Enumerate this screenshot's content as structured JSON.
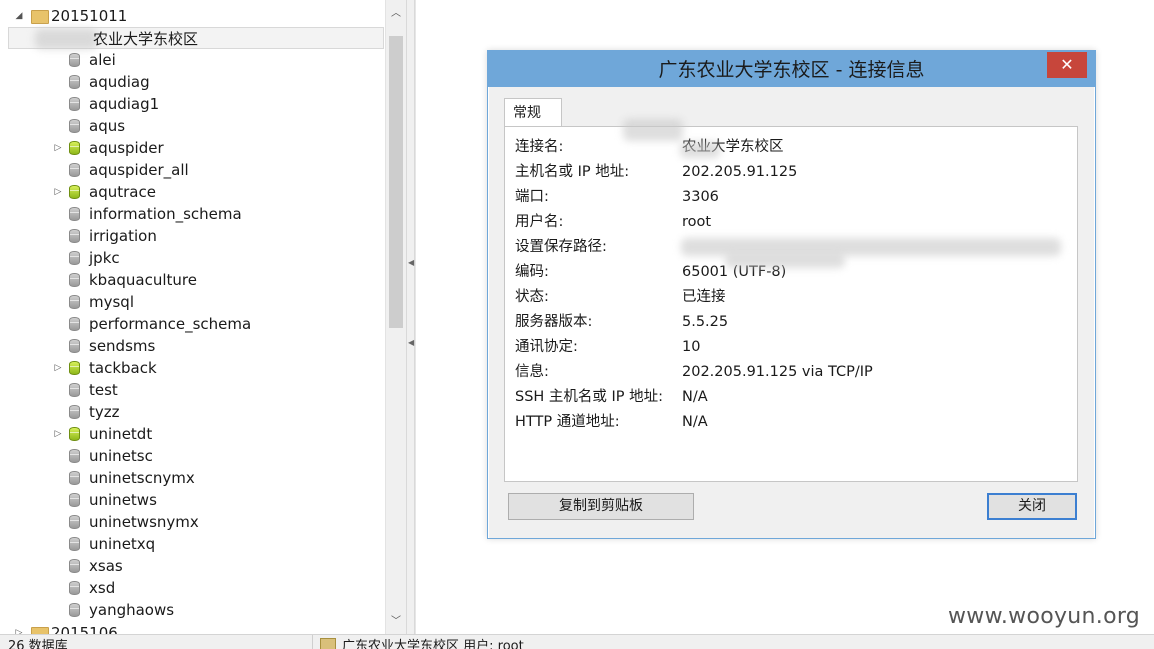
{
  "tree": {
    "parent_folder": "20151011",
    "connection_name": "农业大学东校区",
    "databases": [
      {
        "name": "alei",
        "active": false,
        "expandable": false
      },
      {
        "name": "aqudiag",
        "active": false,
        "expandable": false
      },
      {
        "name": "aqudiag1",
        "active": false,
        "expandable": false
      },
      {
        "name": "aqus",
        "active": false,
        "expandable": false
      },
      {
        "name": "aquspider",
        "active": true,
        "expandable": true
      },
      {
        "name": "aquspider_all",
        "active": false,
        "expandable": false
      },
      {
        "name": "aqutrace",
        "active": true,
        "expandable": true
      },
      {
        "name": "information_schema",
        "active": false,
        "expandable": false
      },
      {
        "name": "irrigation",
        "active": false,
        "expandable": false
      },
      {
        "name": "jpkc",
        "active": false,
        "expandable": false
      },
      {
        "name": "kbaquaculture",
        "active": false,
        "expandable": false
      },
      {
        "name": "mysql",
        "active": false,
        "expandable": false
      },
      {
        "name": "performance_schema",
        "active": false,
        "expandable": false
      },
      {
        "name": "sendsms",
        "active": false,
        "expandable": false
      },
      {
        "name": "tackback",
        "active": true,
        "expandable": true
      },
      {
        "name": "test",
        "active": false,
        "expandable": false
      },
      {
        "name": "tyzz",
        "active": false,
        "expandable": false
      },
      {
        "name": "uninetdt",
        "active": true,
        "expandable": true
      },
      {
        "name": "uninetsc",
        "active": false,
        "expandable": false
      },
      {
        "name": "uninetscnymx",
        "active": false,
        "expandable": false
      },
      {
        "name": "uninetws",
        "active": false,
        "expandable": false
      },
      {
        "name": "uninetwsnymx",
        "active": false,
        "expandable": false
      },
      {
        "name": "uninetxq",
        "active": false,
        "expandable": false
      },
      {
        "name": "xsas",
        "active": false,
        "expandable": false
      },
      {
        "name": "xsd",
        "active": false,
        "expandable": false
      },
      {
        "name": "yanghaows",
        "active": false,
        "expandable": false
      }
    ],
    "next_folder": "2015106"
  },
  "status_bar": {
    "db_count": "26 数据库",
    "connection_user": "广东农业大学东校区  用户: root"
  },
  "dialog": {
    "title": "广东农业大学东校区 - 连接信息",
    "close_symbol": "✕",
    "tab_label": "常规",
    "rows": [
      {
        "key": "连接名:",
        "value": "农业大学东校区"
      },
      {
        "key": "主机名或 IP 地址:",
        "value": "202.205.91.125"
      },
      {
        "key": "端口:",
        "value": "3306"
      },
      {
        "key": "用户名:",
        "value": "root"
      },
      {
        "key": "设置保存路径:",
        "value": ""
      },
      {
        "key": "编码:",
        "value": "65001 (UTF-8)"
      },
      {
        "key": "状态:",
        "value": "已连接"
      },
      {
        "key": "服务器版本:",
        "value": "5.5.25"
      },
      {
        "key": "通讯协定:",
        "value": "10"
      },
      {
        "key": "信息:",
        "value": "202.205.91.125 via TCP/IP"
      },
      {
        "key": "SSH 主机名或 IP 地址:",
        "value": "N/A"
      },
      {
        "key": "HTTP 通道地址:",
        "value": "N/A"
      }
    ],
    "copy_button": "复制到剪贴板",
    "close_button": "关闭"
  },
  "watermark": "www.wooyun.org",
  "colors": {
    "dialog_border": "#6fa7d9",
    "close_button_red": "#c7463b",
    "active_db_green": "#a5cc22",
    "inactive_db_gray": "#9a9a9a"
  }
}
